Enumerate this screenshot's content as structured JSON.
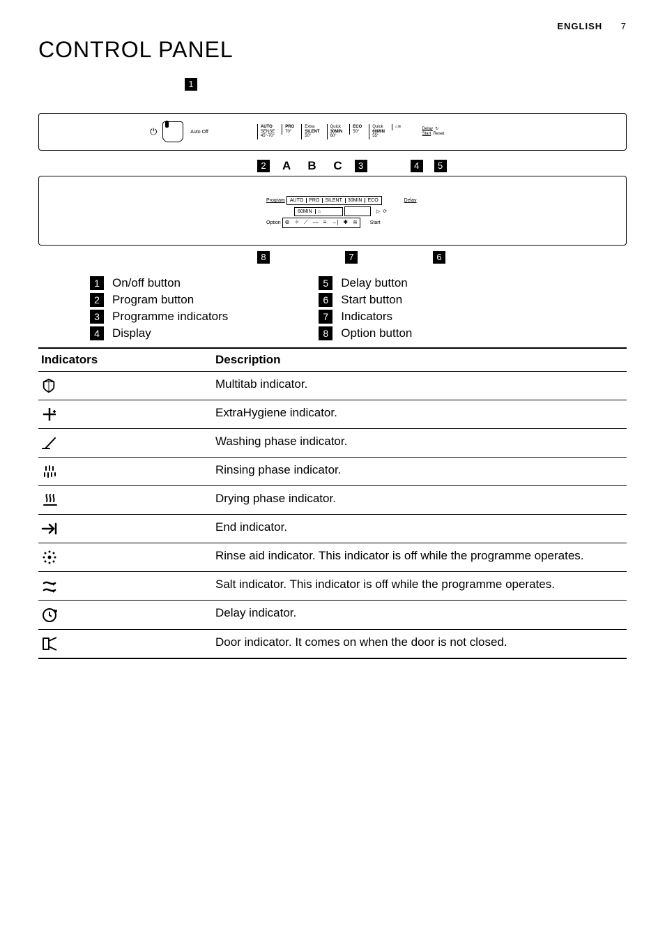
{
  "header": {
    "lang": "ENGLISH",
    "page": "7"
  },
  "title": "CONTROL PANEL",
  "topPanel": {
    "autoOff": "Auto Off",
    "programs": [
      {
        "l1": "AUTO",
        "l2": "SENSE",
        "l3": "45°-70°"
      },
      {
        "l1": "PRO",
        "l2": "70°",
        "l3": ""
      },
      {
        "l1": "Extra",
        "l2": "SILENT",
        "l3": "50°"
      },
      {
        "l1": "Quick",
        "l2": "30MIN",
        "l3": "60°"
      },
      {
        "l1": "ECO",
        "l2": "50°",
        "l3": ""
      },
      {
        "l1": "Quick",
        "l2": "60MIN",
        "l3": "55°"
      },
      {
        "l1": "⌂≋",
        "l2": "",
        "l3": ""
      }
    ],
    "delay": {
      "top": "Delay",
      "mid": "Start",
      "right": "↻\nReset"
    }
  },
  "midLabels": {
    "abc": "A B C"
  },
  "midPanel": {
    "left1": "Program",
    "row1": [
      "AUTO",
      "PRO",
      "SILENT",
      "30MIN",
      "ECO"
    ],
    "row2": [
      "60MIN",
      "⌂"
    ],
    "left2": "Option",
    "rightDelay": "Delay",
    "rightStart": "Start",
    "icons": [
      "⊛",
      "✧",
      "⟋",
      "〰",
      "≡",
      "→|",
      "✱",
      "≊"
    ]
  },
  "callouts": {
    "c1": "1",
    "c2": "2",
    "c3": "3",
    "c4": "4",
    "c5": "5",
    "c6": "6",
    "c7": "7",
    "c8": "8"
  },
  "legend": [
    {
      "n": "1",
      "t": "On/off button"
    },
    {
      "n": "2",
      "t": "Program button"
    },
    {
      "n": "3",
      "t": "Programme indicators"
    },
    {
      "n": "4",
      "t": "Display"
    },
    {
      "n": "5",
      "t": "Delay button"
    },
    {
      "n": "6",
      "t": "Start button"
    },
    {
      "n": "7",
      "t": "Indicators"
    },
    {
      "n": "8",
      "t": "Option button"
    }
  ],
  "table": {
    "h1": "Indicators",
    "h2": "Description",
    "rows": [
      {
        "icon": "multitab",
        "desc": "Multitab indicator."
      },
      {
        "icon": "extrahygiene",
        "desc": "ExtraHygiene indicator."
      },
      {
        "icon": "washing",
        "desc": "Washing phase indicator."
      },
      {
        "icon": "rinsing",
        "desc": "Rinsing phase indicator."
      },
      {
        "icon": "drying",
        "desc": "Drying phase indicator."
      },
      {
        "icon": "end",
        "desc": "End indicator."
      },
      {
        "icon": "rinseaid",
        "desc": "Rinse aid indicator. This indicator is off while the programme operates."
      },
      {
        "icon": "salt",
        "desc": "Salt indicator. This indicator is off while the programme operates."
      },
      {
        "icon": "delay",
        "desc": "Delay indicator."
      },
      {
        "icon": "door",
        "desc": "Door indicator. It comes on when the door is not closed."
      }
    ]
  }
}
